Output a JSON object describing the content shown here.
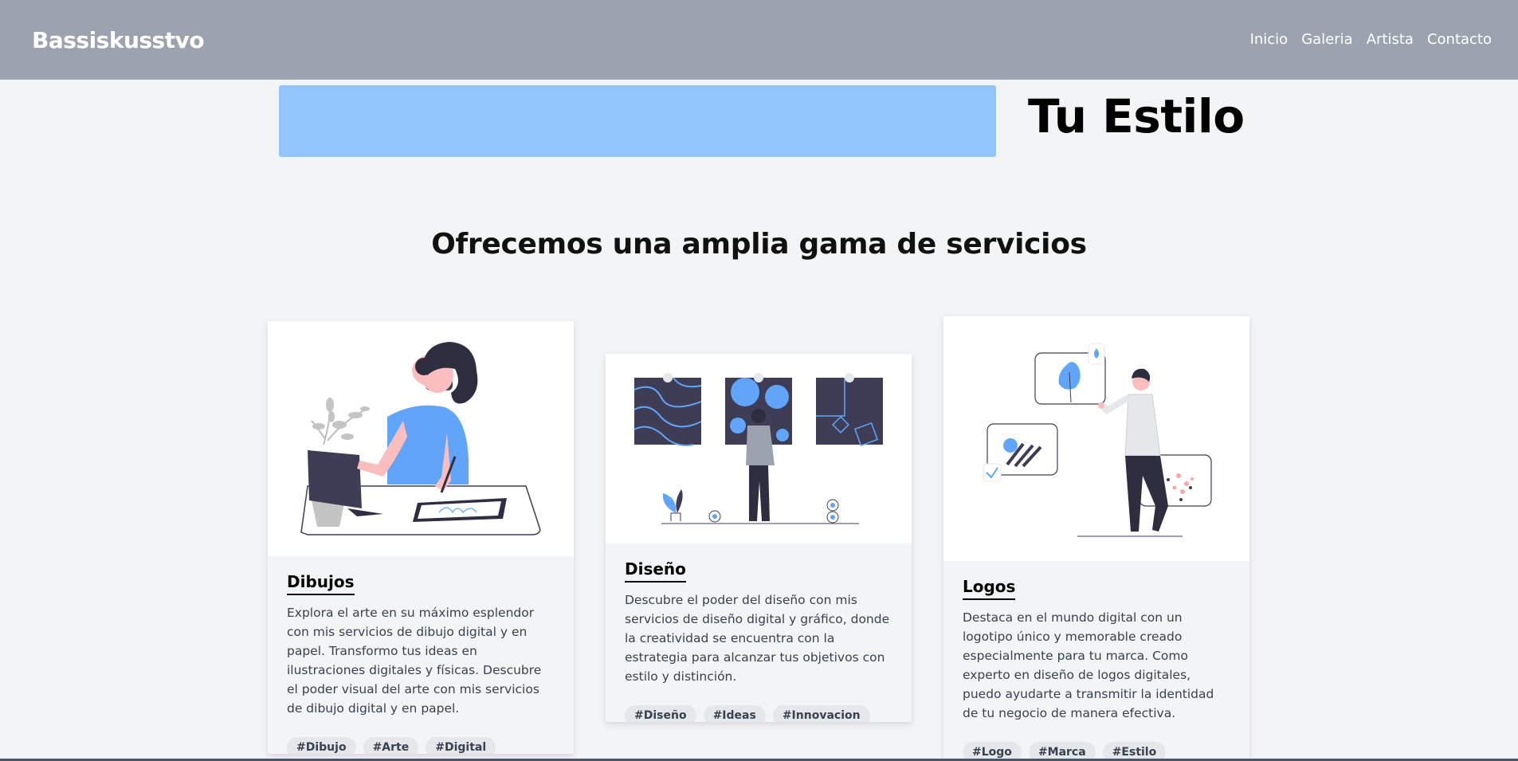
{
  "header": {
    "brand": "Bassiskusstvo",
    "nav": [
      "Inicio",
      "Galeria",
      "Artista",
      "Contacto"
    ]
  },
  "hero": {
    "title": "Tu Estilo",
    "box_color": "#93c5fd"
  },
  "services": {
    "heading": "Ofrecemos una amplia gama de servicios",
    "cards": [
      {
        "title": "Dibujos",
        "illustration": "person-drawing-on-tablet-illustration",
        "text": "Explora el arte en su máximo esplendor con mis servicios de dibujo digital y en papel. Transformo tus ideas en ilustraciones digitales y físicas. Descubre el poder visual del arte con mis servicios de dibujo digital y en papel.",
        "tags": [
          "#Dibujo",
          "#Arte",
          "#Digital"
        ]
      },
      {
        "title": "Diseño",
        "illustration": "person-viewing-art-gallery-illustration",
        "text": "Descubre el poder del diseño con mis servicios de diseño digital y gráfico, donde la creatividad se encuentra con la estrategia para alcanzar tus objetivos con estilo y distinción.",
        "tags": [
          "#Diseño",
          "#Ideas",
          "#Innovacion"
        ]
      },
      {
        "title": "Logos",
        "illustration": "person-with-logo-boards-illustration",
        "text": "Destaca en el mundo digital con un logotipo único y memorable creado especialmente para tu marca. Como experto en diseño de logos digitales, puedo ayudarte a transmitir la identidad de tu negocio de manera efectiva.",
        "tags": [
          "#Logo",
          "#Marca",
          "#Estilo"
        ]
      }
    ]
  },
  "colors": {
    "topbar": "#9ca3af",
    "background": "#f3f4f6",
    "accent": "#60a5fa",
    "dark": "#3f3d56"
  }
}
